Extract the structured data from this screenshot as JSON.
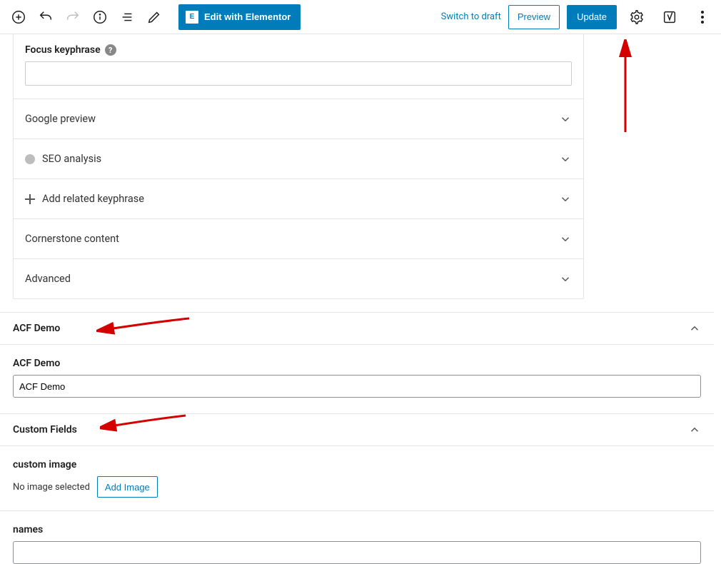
{
  "toolbar": {
    "elementor_label": "Edit with Elementor",
    "switch_draft": "Switch to draft",
    "preview": "Preview",
    "update": "Update"
  },
  "yoast": {
    "focus_label": "Focus keyphrase",
    "rows": {
      "google": "Google preview",
      "seo": "SEO analysis",
      "related": "Add related keyphrase",
      "cornerstone": "Cornerstone content",
      "advanced": "Advanced"
    }
  },
  "acf": {
    "panel_title": "ACF Demo",
    "field_label": "ACF Demo",
    "field_value": "ACF Demo"
  },
  "cf": {
    "panel_title": "Custom Fields",
    "image_label": "custom image",
    "no_image": "No image selected",
    "add_image": "Add Image",
    "names_label": "names"
  }
}
